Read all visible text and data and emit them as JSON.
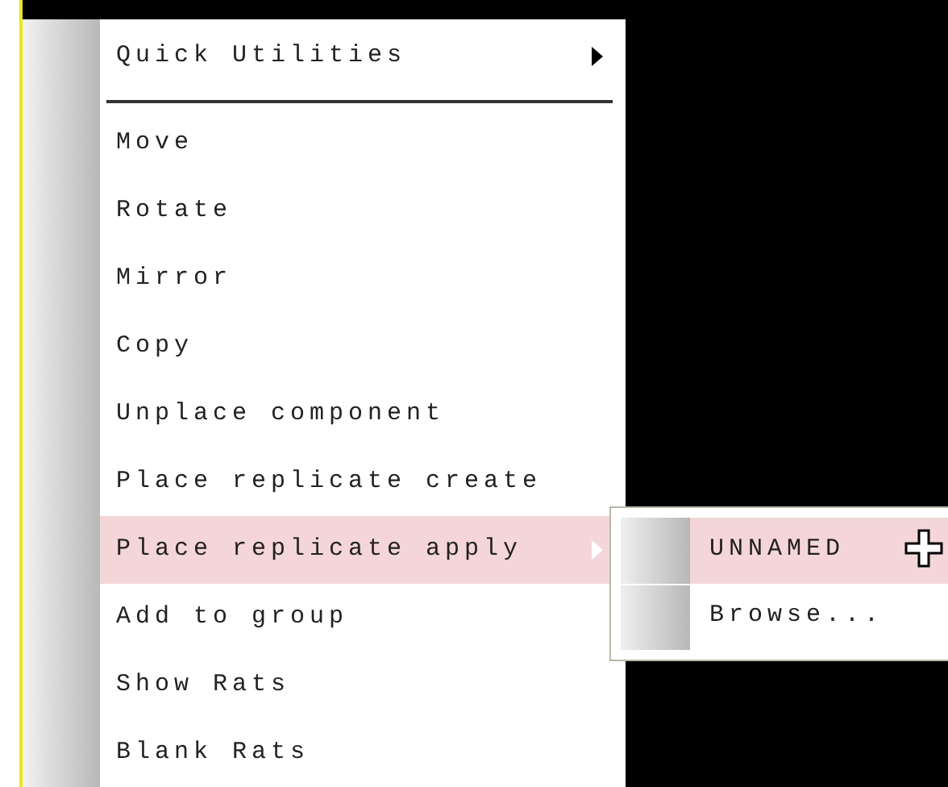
{
  "menu": {
    "items": [
      {
        "kind": "item",
        "label": "Quick Utilities",
        "has_submenu": true,
        "selected": false
      },
      {
        "kind": "separator"
      },
      {
        "kind": "item",
        "label": "Move",
        "has_submenu": false,
        "selected": false
      },
      {
        "kind": "item",
        "label": "Rotate",
        "has_submenu": false,
        "selected": false
      },
      {
        "kind": "item",
        "label": "Mirror",
        "has_submenu": false,
        "selected": false
      },
      {
        "kind": "item",
        "label": "Copy",
        "has_submenu": false,
        "selected": false
      },
      {
        "kind": "item",
        "label": "Unplace component",
        "has_submenu": false,
        "selected": false
      },
      {
        "kind": "item",
        "label": "Place replicate create",
        "has_submenu": false,
        "selected": false
      },
      {
        "kind": "item",
        "label": "Place replicate apply",
        "has_submenu": true,
        "selected": true
      },
      {
        "kind": "item",
        "label": "Add to group",
        "has_submenu": false,
        "selected": false
      },
      {
        "kind": "item",
        "label": "Show Rats",
        "has_submenu": false,
        "selected": false
      },
      {
        "kind": "item",
        "label": "Blank Rats",
        "has_submenu": false,
        "selected": false
      }
    ]
  },
  "submenu": {
    "items": [
      {
        "label": "UNNAMED",
        "selected": true
      },
      {
        "label": "Browse...",
        "selected": false
      }
    ]
  }
}
